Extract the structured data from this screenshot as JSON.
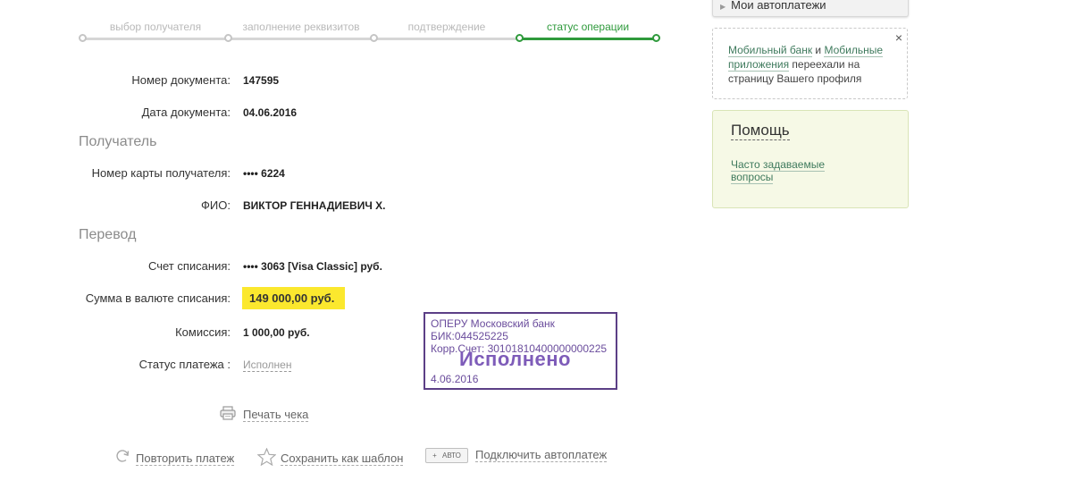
{
  "stepper": {
    "steps": [
      {
        "label": "выбор получателя",
        "active": false
      },
      {
        "label": "заполнение реквизитов",
        "active": false
      },
      {
        "label": "подтверждение",
        "active": false
      },
      {
        "label": "статус операции",
        "active": true
      }
    ]
  },
  "document": {
    "number_label": "Номер документа:",
    "number_value": "147595",
    "date_label": "Дата документа:",
    "date_value": "04.06.2016"
  },
  "recipient": {
    "section_title": "Получатель",
    "card_label": "Номер карты получателя:",
    "card_value": "•••• 6224",
    "name_label": "ФИО:",
    "name_value": "ВИКТОР ГЕННАДИЕВИЧ Х."
  },
  "transfer": {
    "section_title": "Перевод",
    "account_label": "Счет списания:",
    "account_value": "•••• 3063  [Visa Classic]  руб.",
    "amount_label": "Сумма в валюте списания:",
    "amount_value": "149 000,00  руб.",
    "fee_label": "Комиссия:",
    "fee_value": "1 000,00 руб.",
    "status_label": "Статус платежа :",
    "status_value": "Исполнен"
  },
  "stamp": {
    "line1": "ОПЕРУ Московский банк",
    "line2": "БИК:044525225",
    "line3": "Корр.Счет: 30101810400000000225",
    "status": "Исполнено",
    "date": "4.06.2016"
  },
  "actions": {
    "print": "Печать чека",
    "repeat": "Повторить платеж",
    "save_template": "Сохранить как шаблон",
    "auto_badge_plus": "+",
    "auto_badge_text": "АВТО",
    "autopay": "Подключить автоплатеж"
  },
  "sidebar": {
    "autopay_tab": "Мои автоплатежи",
    "notice_link1": "Мобильный банк",
    "notice_and": " и ",
    "notice_link2": "Мобильные приложения",
    "notice_rest": " переехали на страницу Вашего профиля",
    "close_glyph": "×",
    "help_title": "Помощь",
    "faq_link": "Часто задаваемые вопросы"
  },
  "colors": {
    "accent_green": "#2f9a3c",
    "highlight_yellow": "#fbe82e",
    "stamp_purple": "#5c3f86"
  }
}
